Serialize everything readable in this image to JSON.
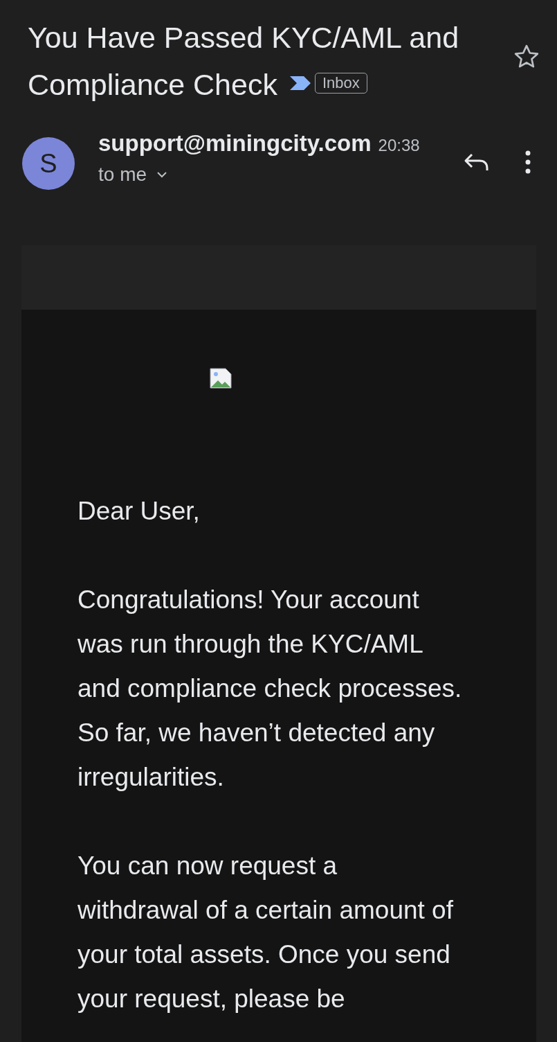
{
  "subject": "You Have Passed KYC/AML and Compliance Check",
  "label": "Inbox",
  "important": true,
  "starred": false,
  "sender": {
    "initial": "S",
    "email": "support@miningcity.com",
    "time": "20:38",
    "recipient": "to me"
  },
  "body": [
    "Dear User,",
    "Congratulations! Your account was run through the KYC/AML and compliance check processes. So far, we haven’t detected any irregularities.",
    "You can now request a withdrawal of a certain amount of your total assets. Once you send your request, please be"
  ]
}
